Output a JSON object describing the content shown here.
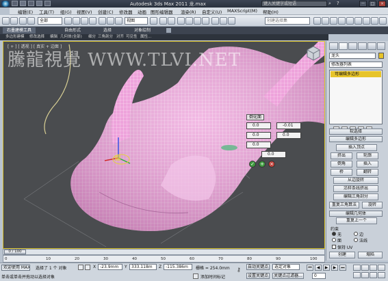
{
  "title_bar": {
    "app_title": "Autodesk 3ds Max  2011    龙.max",
    "search_placeholder": "键入关键字或短语",
    "buttons": [
      "－",
      "□",
      "×"
    ]
  },
  "menu_bar": {
    "items": [
      "编辑(E)",
      "工具(T)",
      "组(G)",
      "视图(V)",
      "创建(C)",
      "修改器",
      "动画",
      "图形编辑器",
      "渲染(R)",
      "自定义(U)",
      "MAXScript(M)",
      "帮助(H)"
    ]
  },
  "toolbar": {
    "selection_filter": "全部",
    "reference_coord": "视图",
    "named_selection": "创建选择集"
  },
  "ribbon": {
    "tabs": [
      "石墨建模工具",
      "自由形式",
      "选择",
      "对象绘制"
    ],
    "sub_items": [
      "多边形建模",
      "修改选择",
      "编辑",
      "几何体(全部)",
      "细分",
      "三角剖分",
      "对齐",
      "可见性",
      "属性..."
    ]
  },
  "viewport": {
    "label": "[ + ] [ 透视 ] [ 真实 + 边面 ]",
    "watermark": "騰龍視覺 WWW.TLVI.NET"
  },
  "bevel_caddy": {
    "title": "倒化面",
    "height": "0.0",
    "outline": "-0.01",
    "field_3": "0.0",
    "field_4": "0.0",
    "field_5": "0.0",
    "field_6": "0.0"
  },
  "command_panel": {
    "object_name": "龙头",
    "modifier_list": "修改器列表",
    "stack_item": "可编辑多边形",
    "rollouts": [
      "软选择",
      "编辑多边形",
      "编辑几何体"
    ],
    "edit_poly_buttons": [
      "插入顶点",
      "挤出",
      "轮廓",
      "倒角",
      "插入",
      "桥",
      "翻转",
      "从边旋转",
      "沿样条线挤出",
      "编辑三角剖分",
      "重复三角算法",
      "旋转"
    ],
    "repeat_last": "重复上一个",
    "constraints_label": "约束",
    "constraints_options": [
      "无",
      "边",
      "面",
      "法线"
    ],
    "preserve_uv": "保持 UV",
    "create_button": "创建",
    "collapse_button": "塌陷"
  },
  "timeline": {
    "frame_label": "0 / 100",
    "ticks": [
      "0",
      "10",
      "20",
      "30",
      "40",
      "50",
      "60",
      "70",
      "80",
      "90",
      "100"
    ]
  },
  "status_bar": {
    "welcome": "欢迎使用 MAXSc",
    "selection_text": "选择了 1 个 对象",
    "prompt": "单击或单击并拖动以选择对象",
    "x_value": "-23.9mm",
    "y_value": "333.118m",
    "z_value": "-115.386m",
    "grid": "栅格 = 254.0mm",
    "auto_key": "自动关键点",
    "set_key": "设置关键点",
    "key_filters": "关键点过滤器...",
    "selected_object": "选定对象",
    "add_time_tag": "添加时间标记",
    "frame_value": "0"
  },
  "colors": {
    "viewport_bg": "#4a4c4f",
    "mesh": "#ee9fd9",
    "selection_yellow": "#e7c42a",
    "panel": "#c9d0d9"
  }
}
